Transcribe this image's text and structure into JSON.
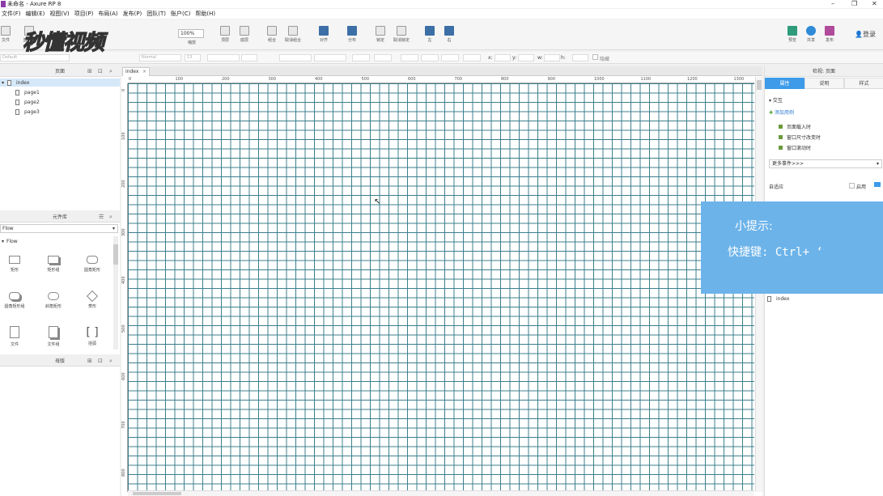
{
  "window": {
    "title": "未命名 - Axure RP 8",
    "controls": {
      "minimize": "–",
      "restore": "❐",
      "close": "✕"
    }
  },
  "menu": [
    "文件(F)",
    "编辑(E)",
    "视图(V)",
    "项目(P)",
    "布局(A)",
    "发布(P)",
    "团队(T)",
    "账户(C)",
    "帮助(H)"
  ],
  "toolbar": {
    "items": [
      "文件",
      "剪贴板",
      "缩放",
      "顶层",
      "底层",
      "组合",
      "取消组合",
      "对齐",
      "分布",
      "锁定",
      "取消锁定",
      "左",
      "右",
      "预览",
      "共享",
      "发布"
    ],
    "zoom": "100%",
    "login": "登录"
  },
  "format": {
    "style": "Default",
    "font": "Normal",
    "size": "13",
    "x_label": "x:",
    "y_label": "y:",
    "w_label": "w:",
    "h_label": "h:",
    "hide": "隐藏"
  },
  "pages_panel": {
    "title": "页面",
    "pages": [
      "index",
      "page1",
      "page2",
      "page3"
    ]
  },
  "library_panel": {
    "title": "元件库",
    "selected": "Flow",
    "group": "Flow",
    "widgets": [
      "矩形",
      "矩形组",
      "圆角矩形",
      "圆角矩形组",
      "斜角矩形",
      "菱形",
      "文件",
      "文件组",
      "括弧"
    ]
  },
  "master_panel": {
    "title": "母版"
  },
  "canvas": {
    "tab": "index",
    "hruler": [
      "0",
      "100",
      "200",
      "300",
      "400",
      "500",
      "600",
      "700",
      "800",
      "900",
      "1000",
      "1100",
      "1200",
      "1300"
    ],
    "vruler": [
      "0",
      "100",
      "200",
      "300",
      "400",
      "500",
      "600",
      "700",
      "800"
    ]
  },
  "inspector": {
    "header": "检视: 页面",
    "tabs": [
      "属性",
      "说明",
      "样式"
    ],
    "section": "交互",
    "add_case": "添加用例",
    "events": [
      "页面载入时",
      "窗口尺寸改变时",
      "窗口滚动时"
    ],
    "more_events": "更多事件>>>",
    "adaptive": "自适应",
    "enable": "启用",
    "page_index": "index"
  },
  "overlay": {
    "tip_title": "小提示:",
    "tip_body": "快捷键: Ctrl+ ‘",
    "watermark": "秒懂视频"
  }
}
